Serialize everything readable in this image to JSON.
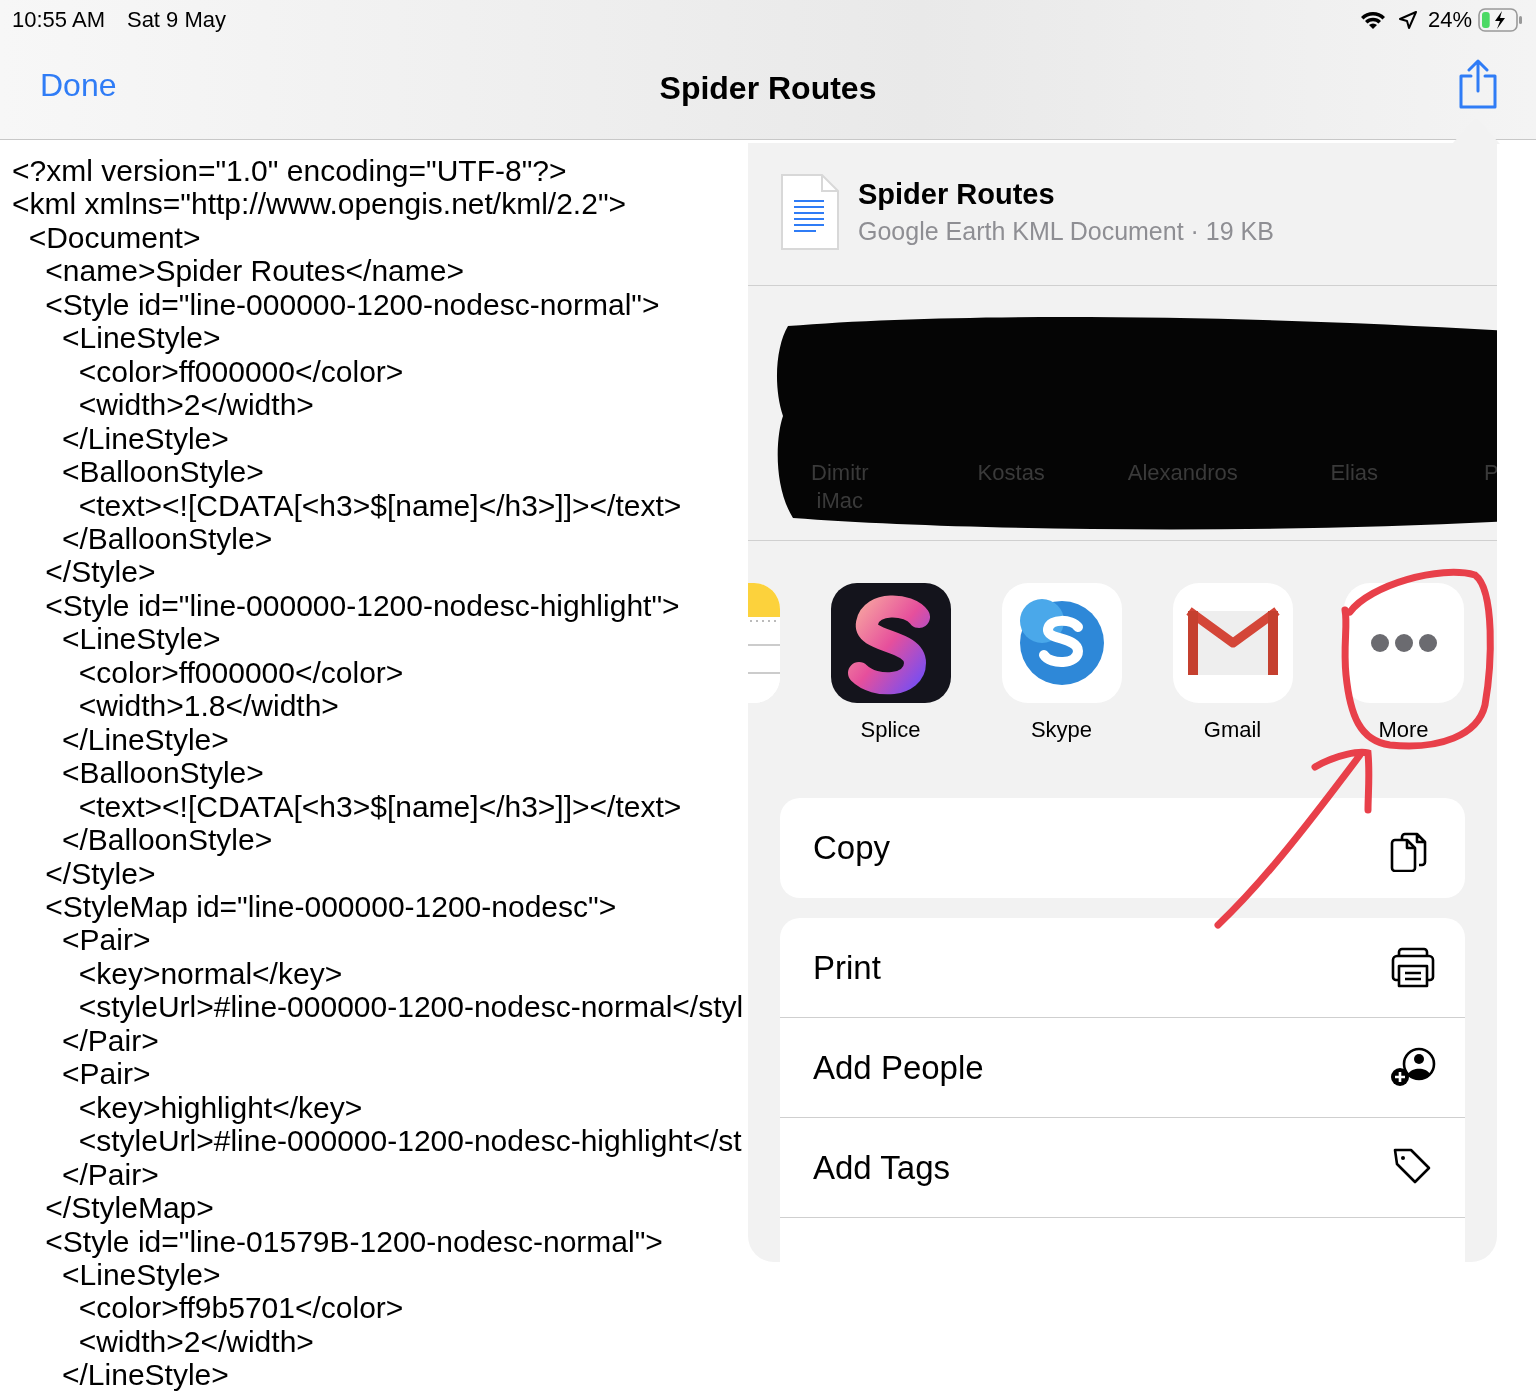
{
  "status_bar": {
    "time": "10:55 AM",
    "date": "Sat 9 May",
    "battery_percent": "24%",
    "battery": {
      "level": 0.24
    }
  },
  "nav_bar": {
    "done": "Done",
    "title": "Spider Routes"
  },
  "code_lines": [
    "<?xml version=\"1.0\" encoding=\"UTF-8\"?>",
    "<kml xmlns=\"http://www.opengis.net/kml/2.2\">",
    "  <Document>",
    "    <name>Spider Routes</name>",
    "    <Style id=\"line-000000-1200-nodesc-normal\">",
    "      <LineStyle>",
    "        <color>ff000000</color>",
    "        <width>2</width>",
    "      </LineStyle>",
    "      <BalloonStyle>",
    "        <text><![CDATA[<h3>$[name]</h3>]]></text>",
    "      </BalloonStyle>",
    "    </Style>",
    "    <Style id=\"line-000000-1200-nodesc-highlight\">",
    "      <LineStyle>",
    "        <color>ff000000</color>",
    "        <width>1.8</width>",
    "      </LineStyle>",
    "      <BalloonStyle>",
    "        <text><![CDATA[<h3>$[name]</h3>]]></text>",
    "      </BalloonStyle>",
    "    </Style>",
    "    <StyleMap id=\"line-000000-1200-nodesc\">",
    "      <Pair>",
    "        <key>normal</key>",
    "        <styleUrl>#line-000000-1200-nodesc-normal</styl",
    "      </Pair>",
    "      <Pair>",
    "        <key>highlight</key>",
    "        <styleUrl>#line-000000-1200-nodesc-highlight</st",
    "      </Pair>",
    "    </StyleMap>",
    "    <Style id=\"line-01579B-1200-nodesc-normal\">",
    "      <LineStyle>",
    "        <color>ff9b5701</color>",
    "        <width>2</width>",
    "      </LineStyle>"
  ],
  "share_sheet": {
    "file": {
      "title": "Spider Routes",
      "subtitle": "Google Earth KML Document · 19 KB"
    },
    "people": [
      {
        "lines": [
          "Dimitr",
          "iMac"
        ]
      },
      {
        "lines": [
          "Kostas"
        ]
      },
      {
        "lines": [
          "Alexandros"
        ]
      },
      {
        "lines": [
          "Elias"
        ]
      },
      {
        "lines": [
          "P"
        ]
      }
    ],
    "apps": [
      {
        "kind": "notes"
      },
      {
        "kind": "splice",
        "name": "Splice"
      },
      {
        "kind": "skype",
        "name": "Skype"
      },
      {
        "kind": "gmail",
        "name": "Gmail"
      },
      {
        "kind": "more",
        "name": "More"
      }
    ],
    "action_groups": [
      [
        {
          "kind": "copy",
          "label": "Copy"
        }
      ],
      [
        {
          "kind": "print",
          "label": "Print"
        },
        {
          "kind": "add-people",
          "label": "Add People"
        },
        {
          "kind": "tag",
          "label": "Add Tags"
        },
        {
          "kind": "partial"
        }
      ]
    ]
  }
}
